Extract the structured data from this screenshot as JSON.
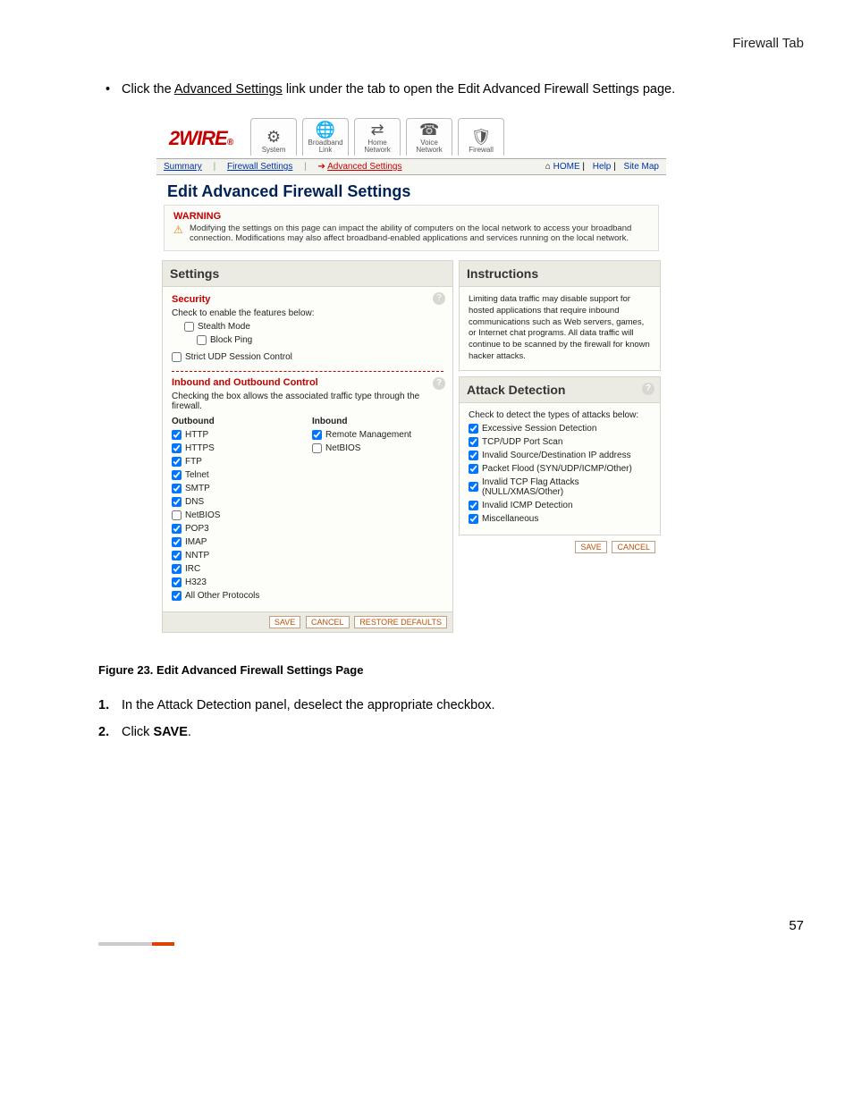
{
  "header": {
    "title": "Firewall Tab"
  },
  "intro": {
    "bullet": "•",
    "pre": "Click the ",
    "link": "Advanced Settings",
    "post": " link under the tab to open the Edit Advanced Firewall Settings page."
  },
  "tabs": [
    {
      "label": "System",
      "icon": "⚙"
    },
    {
      "label": "Broadband Link",
      "icon": "🌐"
    },
    {
      "label": "Home Network",
      "icon": "⇄"
    },
    {
      "label": "Voice Network",
      "icon": "☎"
    },
    {
      "label": "Firewall",
      "icon": "🛡"
    }
  ],
  "subtabs": {
    "summary": "Summary",
    "fwset": "Firewall Settings",
    "adv": "Advanced Settings",
    "home": "HOME",
    "help": "Help",
    "sitemap": "Site Map"
  },
  "pageTitle": "Edit Advanced Firewall Settings",
  "warning": {
    "head": "WARNING",
    "body": "Modifying the settings on this page can impact the ability of computers on the local network to access your broadband connection. Modifications may also affect broadband-enabled applications and services running on the local network."
  },
  "settings": {
    "head": "Settings",
    "security": "Security",
    "checkEnable": "Check to enable the features below:",
    "stealth": "Stealth Mode",
    "blockPing": "Block Ping",
    "strictUDP": "Strict UDP Session Control",
    "io": {
      "head": "Inbound and Outbound Control",
      "desc": "Checking the box allows the associated traffic type through the firewall."
    },
    "outboundHead": "Outbound",
    "inboundHead": "Inbound",
    "outbound": [
      "HTTP",
      "HTTPS",
      "FTP",
      "Telnet",
      "SMTP",
      "DNS",
      "NetBIOS",
      "POP3",
      "IMAP",
      "NNTP",
      "IRC",
      "H323",
      "All Other Protocols"
    ],
    "outboundChecked": [
      true,
      true,
      true,
      true,
      true,
      true,
      false,
      true,
      true,
      true,
      true,
      true,
      true
    ],
    "inbound": [
      "Remote Management",
      "NetBIOS"
    ],
    "inboundChecked": [
      true,
      false
    ],
    "buttons": {
      "save": "SAVE",
      "cancel": "CANCEL",
      "restore": "RESTORE DEFAULTS"
    }
  },
  "instructions": {
    "head": "Instructions",
    "body": "Limiting data traffic may disable support for hosted applications that require inbound communications such as Web servers, games, or Internet chat programs. All data traffic will continue to be scanned by the firewall for known hacker attacks."
  },
  "attack": {
    "head": "Attack Detection",
    "desc": "Check to detect the types of attacks below:",
    "items": [
      "Excessive Session Detection",
      "TCP/UDP Port Scan",
      "Invalid Source/Destination IP address",
      "Packet Flood (SYN/UDP/ICMP/Other)",
      "Invalid TCP Flag Attacks (NULL/XMAS/Other)",
      "Invalid ICMP Detection",
      "Miscellaneous"
    ],
    "buttons": {
      "save": "SAVE",
      "cancel": "CANCEL"
    }
  },
  "caption": "Figure 23. Edit Advanced Firewall Settings Page",
  "steps": [
    {
      "n": "1.",
      "text": "In the Attack Detection panel, deselect the appropriate checkbox."
    },
    {
      "n": "2.",
      "pre": "Click ",
      "bold": "SAVE",
      "post": "."
    }
  ],
  "pageNumber": "57"
}
